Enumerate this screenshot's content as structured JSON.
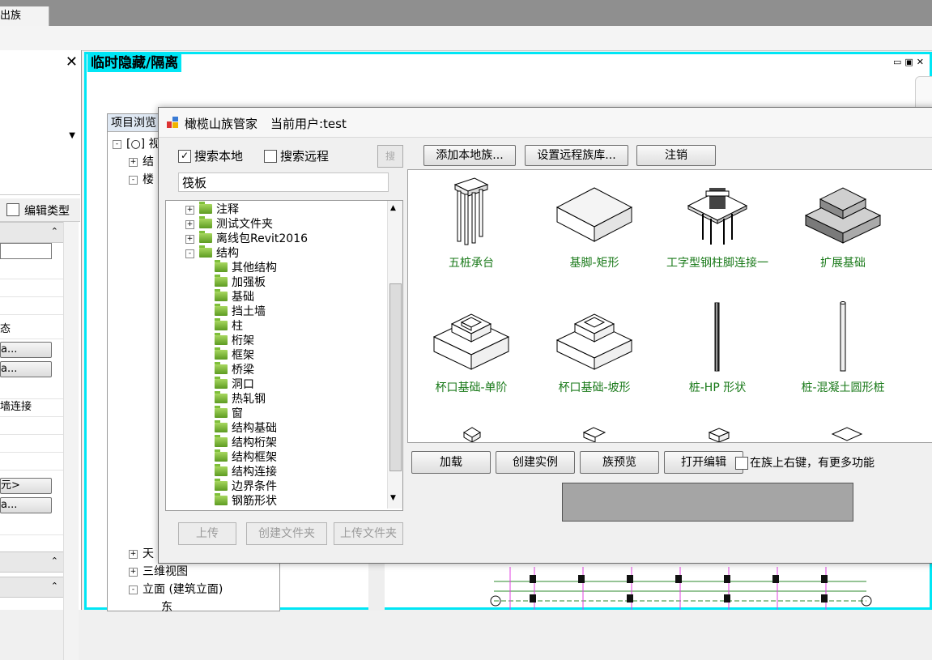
{
  "app": {
    "tab_label": "出族"
  },
  "properties_panel": {
    "close_glyph": "✕",
    "edit_type_label": "编辑类型",
    "rows": [
      {
        "label": "态"
      },
      {
        "button": "a..."
      },
      {
        "button": "a..."
      },
      {
        "label": "墙连接"
      },
      {
        "button": "元>"
      },
      {
        "button": "a..."
      }
    ]
  },
  "view": {
    "title": "临时隐藏/隔离",
    "window_controls": "▭▣✕"
  },
  "project_browser": {
    "title": "项目浏览",
    "nodes": [
      {
        "label": "视"
      },
      {
        "label": "结"
      },
      {
        "label": "楼"
      },
      {
        "label": "天"
      },
      {
        "label": "三维视图"
      },
      {
        "label": "立面 (建筑立面)"
      },
      {
        "label": "东"
      }
    ]
  },
  "dialog": {
    "title": "橄榄山族管家",
    "current_user": "当前用户:test",
    "search_local": "搜索本地",
    "search_local_checked": "✓",
    "search_remote": "搜索远程",
    "search_btn": "搜",
    "search_value": "筏板",
    "tree": [
      {
        "label": "注释",
        "level": 1,
        "toggle": "+"
      },
      {
        "label": "测试文件夹",
        "level": 1,
        "toggle": "+"
      },
      {
        "label": "离线包Revit2016",
        "level": 1,
        "toggle": "+"
      },
      {
        "label": "结构",
        "level": 1,
        "toggle": "-"
      },
      {
        "label": "其他结构",
        "level": 2
      },
      {
        "label": "加强板",
        "level": 2
      },
      {
        "label": "基础",
        "level": 2
      },
      {
        "label": "挡土墙",
        "level": 2
      },
      {
        "label": "柱",
        "level": 2
      },
      {
        "label": "桁架",
        "level": 2
      },
      {
        "label": "框架",
        "level": 2
      },
      {
        "label": "桥梁",
        "level": 2
      },
      {
        "label": "洞口",
        "level": 2
      },
      {
        "label": "热轧钢",
        "level": 2
      },
      {
        "label": "窗",
        "level": 2
      },
      {
        "label": "结构基础",
        "level": 2
      },
      {
        "label": "结构桁架",
        "level": 2
      },
      {
        "label": "结构框架",
        "level": 2
      },
      {
        "label": "结构连接",
        "level": 2
      },
      {
        "label": "边界条件",
        "level": 2
      },
      {
        "label": "钢筋形状",
        "level": 2
      }
    ],
    "bottom_buttons": {
      "upload": "上传",
      "create_folder": "创建文件夹",
      "upload_folder": "上传文件夹"
    },
    "top_buttons": {
      "add_local": "添加本地族...",
      "set_remote": "设置远程族库...",
      "logout": "注销"
    },
    "gallery": [
      {
        "caption": "五桩承台",
        "icon": "pile-cap-icon"
      },
      {
        "caption": "基脚-矩形",
        "icon": "rect-footing-icon"
      },
      {
        "caption": "工字型钢柱脚连接一",
        "icon": "steel-base-icon"
      },
      {
        "caption": "扩展基础",
        "icon": "spread-footing-icon"
      },
      {
        "caption": "杯口基础-单阶",
        "icon": "cup-footing-single-icon"
      },
      {
        "caption": "杯口基础-坡形",
        "icon": "cup-footing-slope-icon"
      },
      {
        "caption": "桩-HP 形状",
        "icon": "hp-pile-icon"
      },
      {
        "caption": "桩-混凝土圆形桩",
        "icon": "round-pile-icon"
      }
    ],
    "action_buttons": {
      "load": "加载",
      "create_instance": "创建实例",
      "preview": "族预览",
      "open_edit": "打开编辑"
    },
    "more_features_label": "在族上右键，有更多功能"
  }
}
